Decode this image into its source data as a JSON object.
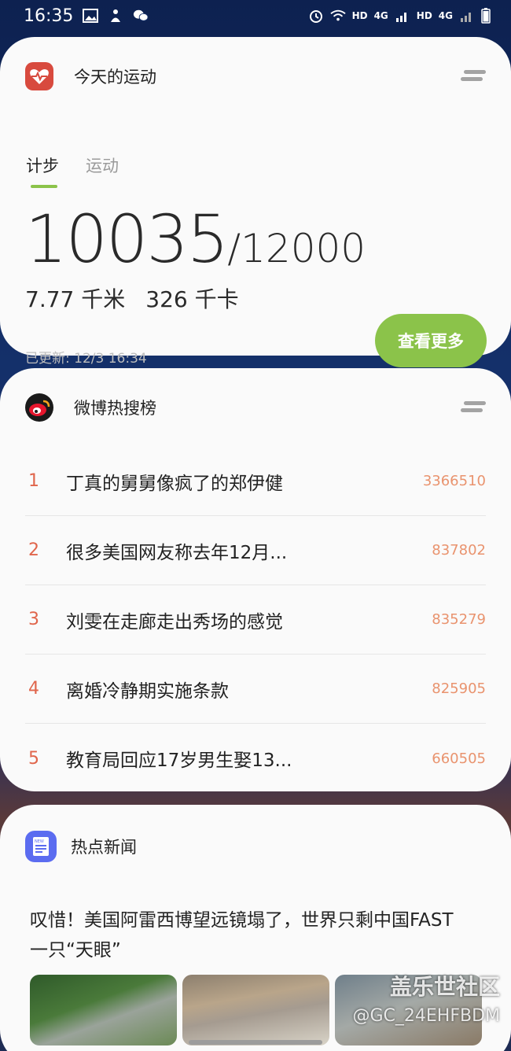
{
  "status_bar": {
    "time": "16:35",
    "net_label_1": "HD",
    "net_label_2": "4G",
    "net_label_3": "HD",
    "net_label_4": "4G",
    "icons": [
      "image-icon",
      "figure-icon",
      "wechat-icon",
      "alarm-icon",
      "wifi-icon",
      "signal-icon",
      "signal-icon",
      "battery-icon"
    ]
  },
  "fitness": {
    "title": "今天的运动",
    "tabs": [
      {
        "label": "计步",
        "active": true
      },
      {
        "label": "运动",
        "active": false
      }
    ],
    "steps": "10035",
    "goal": "/12000",
    "distance": "7.77 千米",
    "calories": "326 千卡",
    "updated": "已更新: 12/3 16:34",
    "more_button": "查看更多",
    "progress_fraction": 0.836,
    "accent": "#8bc34a"
  },
  "weibo": {
    "title": "微博热搜榜",
    "items": [
      {
        "rank": "1",
        "text": "丁真的舅舅像疯了的郑伊健",
        "count": "3366510"
      },
      {
        "rank": "2",
        "text": "很多美国网友称去年12月...",
        "count": "837802"
      },
      {
        "rank": "3",
        "text": "刘雯在走廊走出秀场的感觉",
        "count": "835279"
      },
      {
        "rank": "4",
        "text": "离婚冷静期实施条款",
        "count": "825905"
      },
      {
        "rank": "5",
        "text": "教育局回应17岁男生娶13...",
        "count": "660505"
      }
    ]
  },
  "news": {
    "title": "热点新闻",
    "icon_label": "NEW",
    "headline": "叹惜！美国阿雷西博望远镜塌了，世界只剩中国FAST一只“天眼”"
  },
  "watermark": {
    "line1": "盖乐世社区",
    "line2": "@GC_24EHFBDM"
  }
}
